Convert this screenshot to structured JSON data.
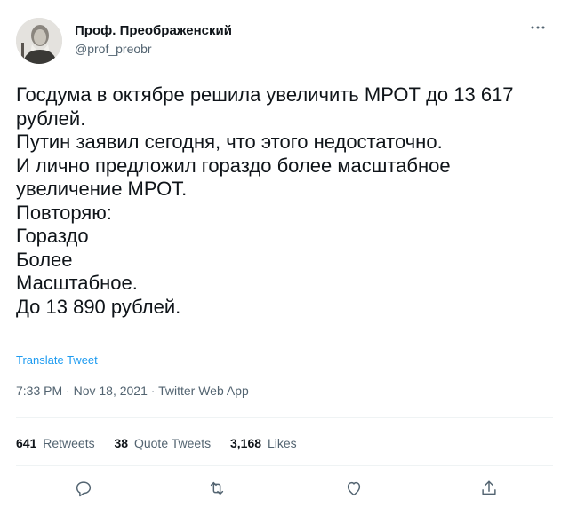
{
  "author": {
    "display_name": "Проф. Преображенский",
    "handle": "@prof_preobr",
    "avatar_icon": "portrait-avatar"
  },
  "more_icon": "more-horizontal-icon",
  "tweet_lines": [
    "Госдума в октябре решила увеличить МРОТ до 13 617",
    "рублей.",
    "Путин заявил сегодня, что этого недостаточно.",
    "И лично предложил гораздо более масштабное",
    "увеличение МРОТ.",
    "Повторяю:",
    "Гораздо",
    "Более",
    "Масштабное.",
    "До 13 890 рублей."
  ],
  "translate_label": "Translate Tweet",
  "meta": {
    "time": "7:33 PM",
    "date": "Nov 18, 2021",
    "source": "Twitter Web App",
    "separator": "·"
  },
  "stats": {
    "retweets_count": "641",
    "retweets_label": "Retweets",
    "quotes_count": "38",
    "quotes_label": "Quote Tweets",
    "likes_count": "3,168",
    "likes_label": "Likes"
  },
  "actions": [
    "reply-icon",
    "retweet-icon",
    "like-icon",
    "share-icon"
  ],
  "colors": {
    "text": "#0f1419",
    "secondary": "#536471",
    "link": "#1d9bf0",
    "divider": "#eff3f4"
  }
}
